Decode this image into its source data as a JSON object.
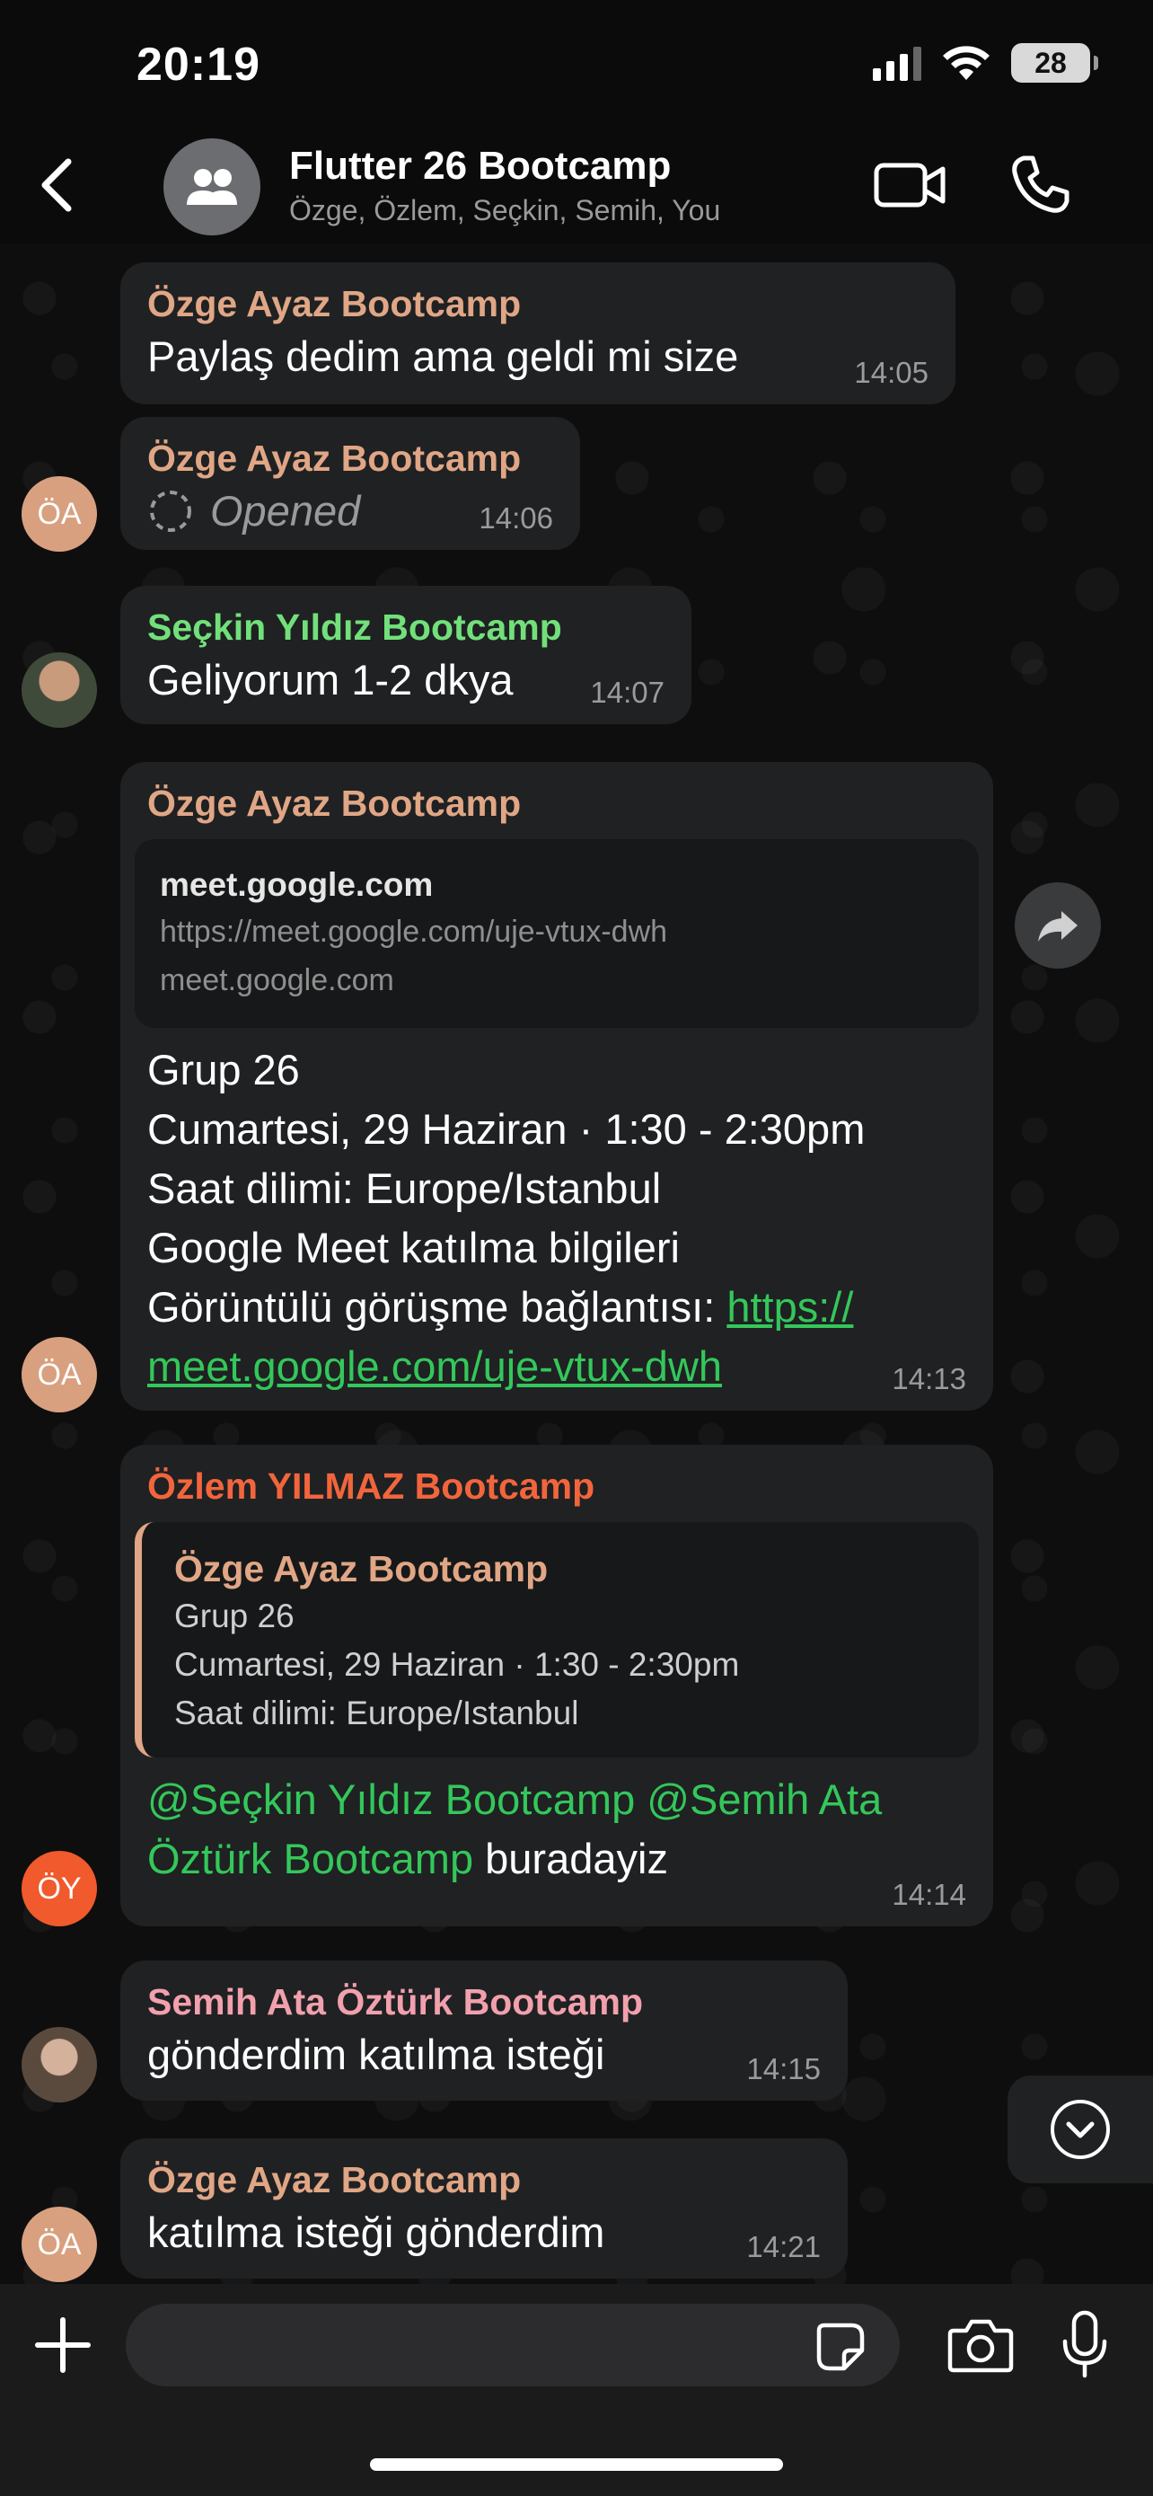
{
  "status_bar": {
    "time": "20:19",
    "battery": "28"
  },
  "header": {
    "title": "Flutter 26 Bootcamp",
    "subtitle": "Özge, Özlem, Seçkin, Semih, You"
  },
  "messages": [
    {
      "sender": "Özge Ayaz Bootcamp",
      "text": "Paylaş dedim ama geldi mi size",
      "time": "14:05"
    },
    {
      "sender": "Özge Ayaz Bootcamp",
      "text": "Opened",
      "time": "14:06",
      "avatar": "ÖA"
    },
    {
      "sender": "Seçkin Yıldız Bootcamp",
      "text": "Geliyorum 1-2 dkya",
      "time": "14:07"
    },
    {
      "sender": "Özge Ayaz Bootcamp",
      "preview": {
        "title": "meet.google.com",
        "url": "https://meet.google.com/uje-vtux-dwh",
        "domain": "meet.google.com"
      },
      "lines": [
        "Grup 26",
        "Cumartesi, 29 Haziran · 1:30 - 2:30pm",
        "Saat dilimi: Europe/Istanbul",
        "Google Meet katılma bilgileri",
        "Görüntülü görüşme bağlantısı: "
      ],
      "link_part1": "https://",
      "link_part2": "meet.google.com/uje-vtux-dwh",
      "time": "14:13",
      "avatar": "ÖA"
    },
    {
      "sender": "Özlem YILMAZ Bootcamp",
      "quote": {
        "sender": "Özge Ayaz Bootcamp",
        "lines": [
          "Grup 26",
          "Cumartesi, 29 Haziran · 1:30 - 2:30pm",
          "Saat dilimi: Europe/Istanbul"
        ]
      },
      "mention1": "@Seçkin Yıldız Bootcamp",
      "mention2a": "@Semih Ata",
      "mention2b": "Öztürk Bootcamp",
      "text_rest": " buradayiz",
      "time": "14:14",
      "avatar": "ÖY"
    },
    {
      "sender": "Semih Ata Öztürk Bootcamp",
      "text": "gönderdim katılma isteği",
      "time": "14:15"
    },
    {
      "sender": "Özge Ayaz Bootcamp",
      "text": "katılma isteği gönderdim",
      "time": "14:21",
      "avatar": "ÖA"
    }
  ],
  "input": {
    "placeholder": ""
  },
  "colors": {
    "ozge": "#e0a685",
    "seckin": "#72e07a",
    "ozlem": "#f2653c",
    "semih": "#f2a0ad",
    "link": "#34c75a",
    "bubble": "#1f2123"
  }
}
